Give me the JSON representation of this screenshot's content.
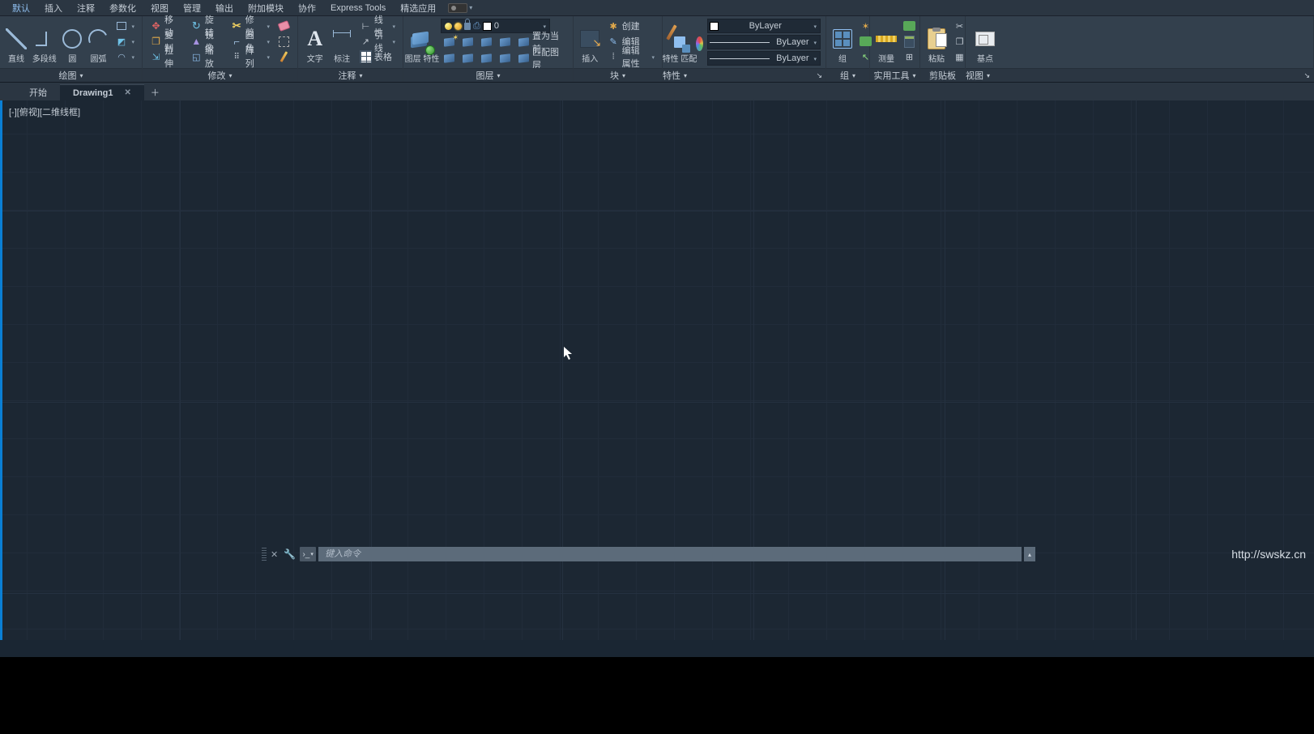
{
  "menu": [
    "默认",
    "插入",
    "注释",
    "参数化",
    "视图",
    "管理",
    "输出",
    "附加模块",
    "协作",
    "Express Tools",
    "精选应用"
  ],
  "ribbon": {
    "draw": {
      "title": "绘图",
      "line": "直线",
      "polyline": "多段线",
      "circle": "圆",
      "arc": "圆弧"
    },
    "modify": {
      "title": "修改",
      "move": "移动",
      "rotate": "旋转",
      "trim": "修剪",
      "copy": "复制",
      "mirror": "镜像",
      "fillet": "圆角",
      "stretch": "拉伸",
      "scale": "缩放",
      "array": "阵列"
    },
    "annotate": {
      "title": "注释",
      "text": "文字",
      "dim": "标注",
      "linetype": "线性",
      "leader": "引线",
      "table": "表格"
    },
    "layer": {
      "title": "图层",
      "prop": "图层\n特性",
      "current": "0",
      "make": "置为当前",
      "match": "匹配图层"
    },
    "block": {
      "title": "块",
      "insert": "插入",
      "create": "创建",
      "edit": "编辑",
      "editprop": "编辑属性"
    },
    "prop": {
      "title": "特性",
      "match": "特性\n匹配",
      "bylayer": "ByLayer"
    },
    "group": {
      "title": "组",
      "label": "组"
    },
    "util": {
      "title": "实用工具",
      "measure": "测量"
    },
    "clip": {
      "title": "剪贴板",
      "paste": "粘贴"
    },
    "view": {
      "title": "视图",
      "base": "基点"
    }
  },
  "tabs": {
    "start": "开始",
    "active": "Drawing1"
  },
  "viewport": "[-][俯视][二维线框]",
  "cmd_placeholder": "键入命令",
  "watermark": "http://swskz.cn"
}
